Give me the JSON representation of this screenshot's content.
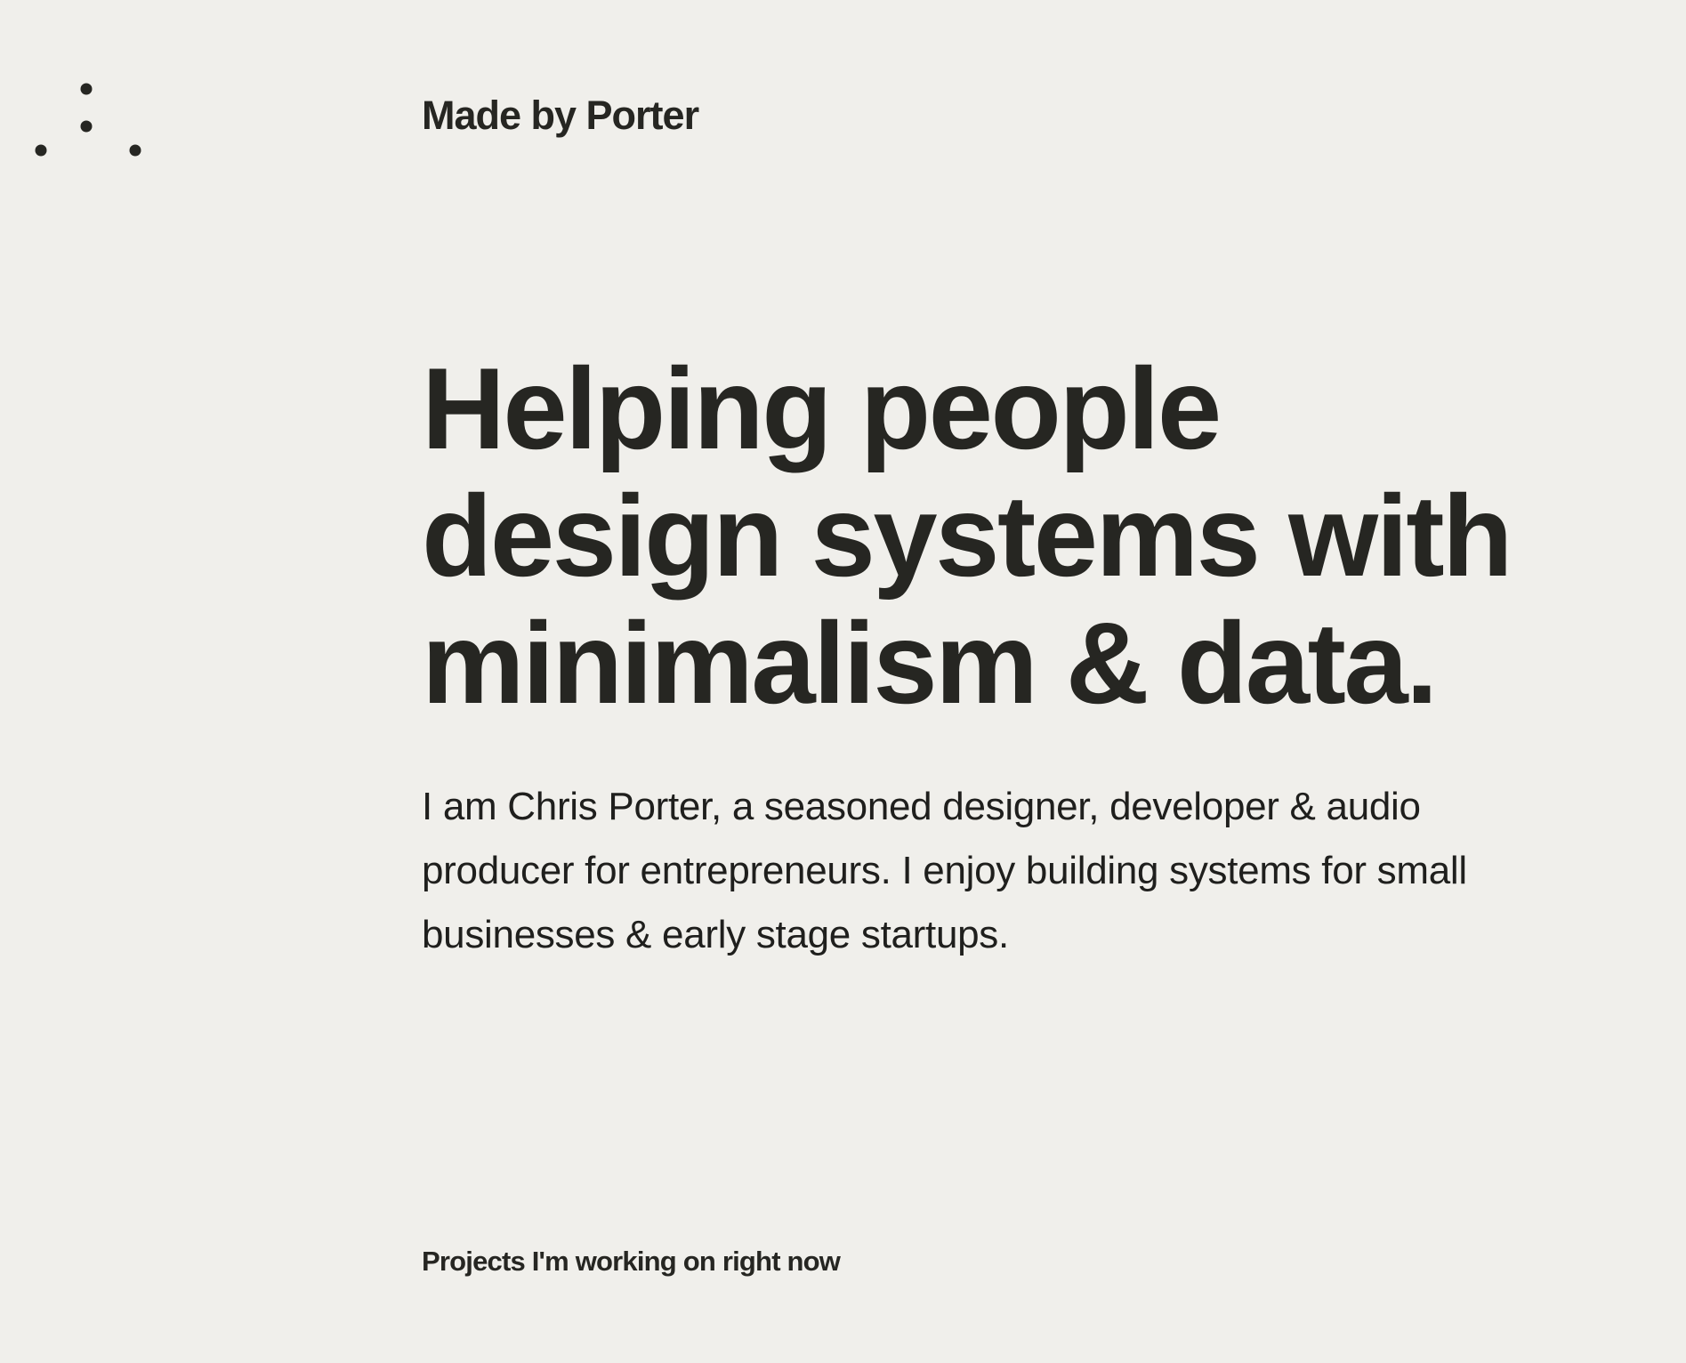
{
  "logo": {
    "icon": "dots-logo-icon"
  },
  "header": {
    "brand": "Made by Porter"
  },
  "hero": {
    "headline_lines": [
      "Helping people",
      "design systems with",
      "minimalism & data."
    ],
    "intro": "I am Chris Porter, a seasoned designer, developer & audio producer for entrepreneurs. I enjoy building systems for small businesses & early stage startups."
  },
  "projects": {
    "heading": "Projects I'm working on right now"
  },
  "colors": {
    "background": "#f0efeb",
    "text": "#262622"
  }
}
